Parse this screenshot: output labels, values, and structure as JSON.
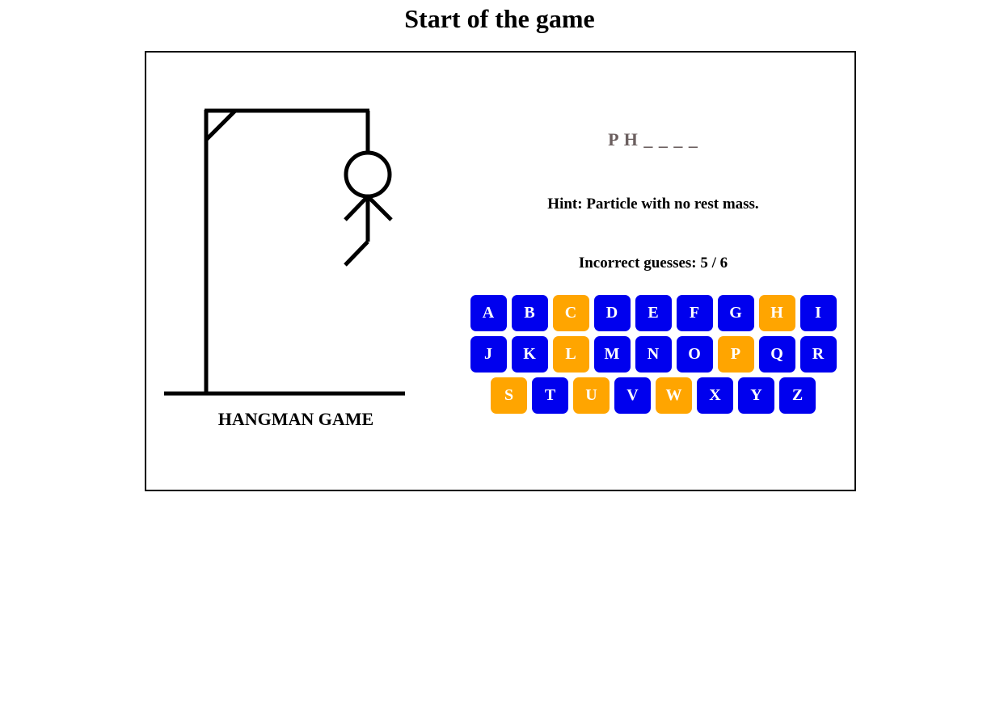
{
  "page": {
    "title": "Start of the game"
  },
  "game": {
    "brand": "HANGMAN GAME",
    "word_display": "P H _ _ _ _",
    "hint": "Hint: Particle with no rest mass.",
    "incorrect_guesses": "Incorrect guesses: 5 / 6",
    "wrong_count": 5,
    "max_wrong": 6
  },
  "colors": {
    "key_available": "#0000ee",
    "key_used": "#ffa500",
    "word_text": "#6b5f5f"
  },
  "keyboard": {
    "rows": [
      [
        {
          "letter": "A",
          "used": false
        },
        {
          "letter": "B",
          "used": false
        },
        {
          "letter": "C",
          "used": true
        },
        {
          "letter": "D",
          "used": false
        },
        {
          "letter": "E",
          "used": false
        },
        {
          "letter": "F",
          "used": false
        },
        {
          "letter": "G",
          "used": false
        },
        {
          "letter": "H",
          "used": true
        },
        {
          "letter": "I",
          "used": false
        }
      ],
      [
        {
          "letter": "J",
          "used": false
        },
        {
          "letter": "K",
          "used": false
        },
        {
          "letter": "L",
          "used": true
        },
        {
          "letter": "M",
          "used": false
        },
        {
          "letter": "N",
          "used": false
        },
        {
          "letter": "O",
          "used": false
        },
        {
          "letter": "P",
          "used": true
        },
        {
          "letter": "Q",
          "used": false
        },
        {
          "letter": "R",
          "used": false
        }
      ],
      [
        {
          "letter": "S",
          "used": true
        },
        {
          "letter": "T",
          "used": false
        },
        {
          "letter": "U",
          "used": true
        },
        {
          "letter": "V",
          "used": false
        },
        {
          "letter": "W",
          "used": true
        },
        {
          "letter": "X",
          "used": false
        },
        {
          "letter": "Y",
          "used": false
        },
        {
          "letter": "Z",
          "used": false
        }
      ]
    ]
  }
}
